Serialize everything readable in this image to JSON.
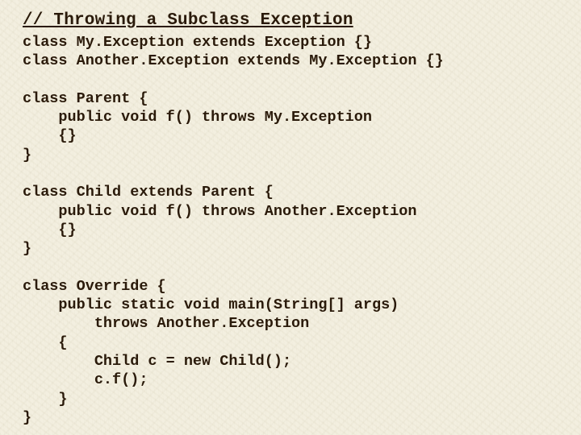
{
  "title": "// Throwing a Subclass Exception",
  "code": "class My.Exception extends Exception {}\nclass Another.Exception extends My.Exception {}\n\nclass Parent {\n    public void f() throws My.Exception\n    {}\n}\n\nclass Child extends Parent {\n    public void f() throws Another.Exception\n    {}\n}\n\nclass Override {\n    public static void main(String[] args)\n        throws Another.Exception\n    {\n        Child c = new Child();\n        c.f();\n    }\n}"
}
